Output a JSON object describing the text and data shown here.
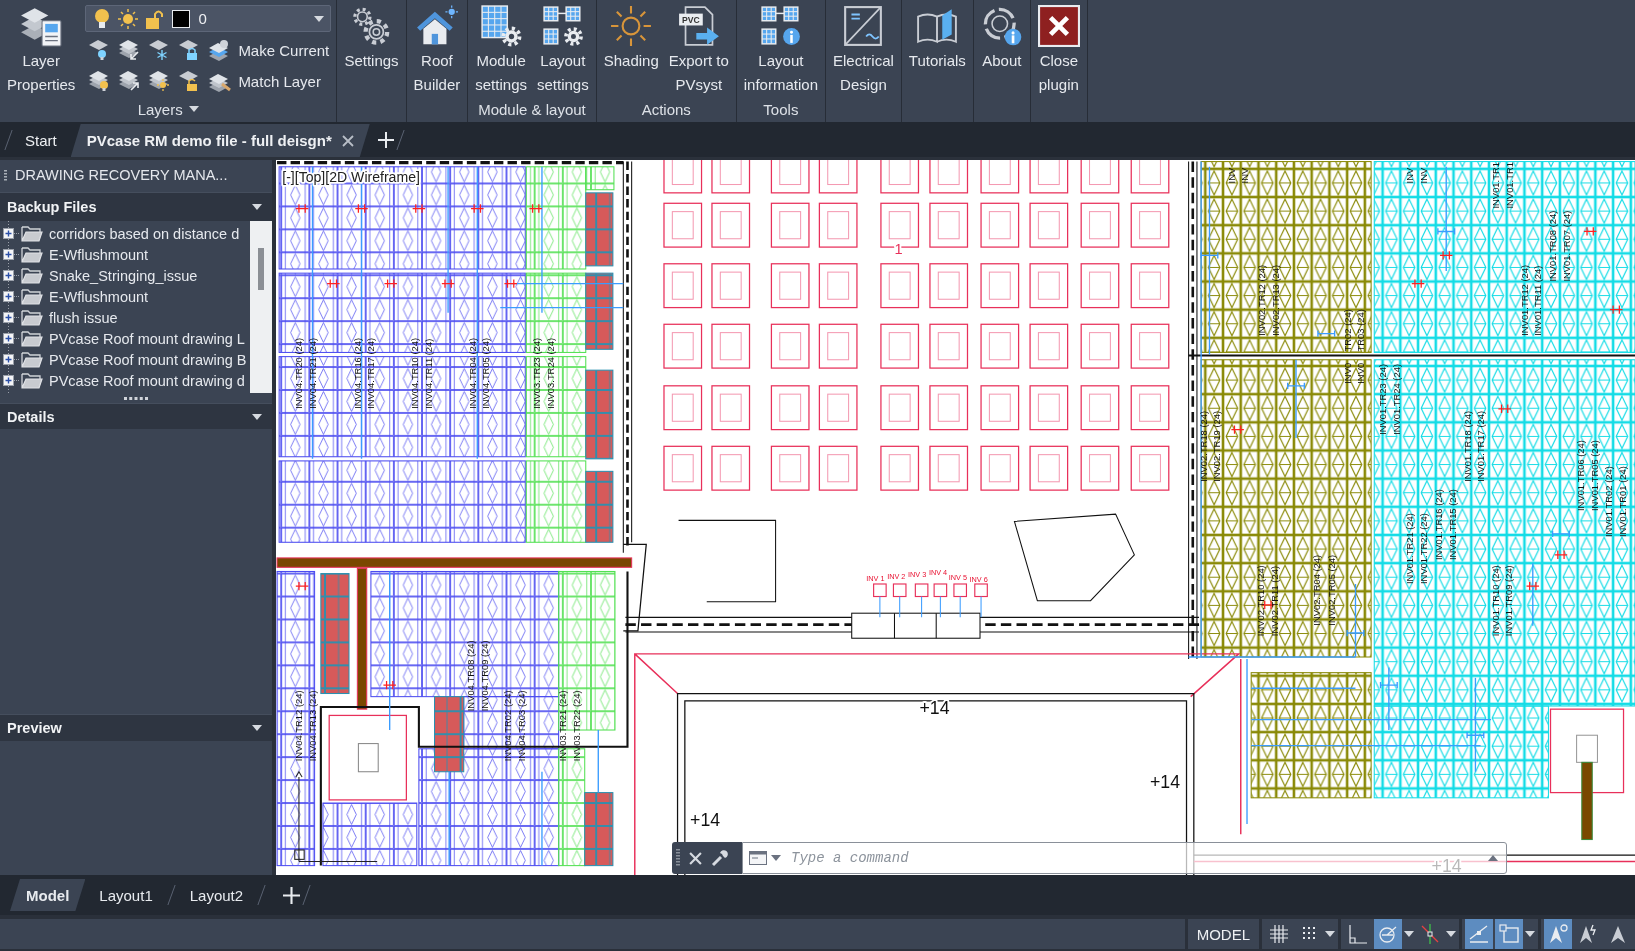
{
  "ribbon": {
    "layers": {
      "title": "Layers",
      "properties_label": [
        "Layer",
        "Properties"
      ],
      "current_layer": "0",
      "tools": [
        {
          "label": "Make Current"
        },
        {
          "label": "Match Layer"
        }
      ]
    },
    "panels": [
      {
        "buttons": [
          {
            "kind": "settings",
            "label": [
              "Settings"
            ]
          }
        ]
      },
      {
        "buttons": [
          {
            "kind": "roof",
            "label": [
              "Roof",
              "Builder"
            ]
          }
        ]
      },
      {
        "title": "Module & layout",
        "buttons": [
          {
            "kind": "module",
            "label": [
              "Module",
              "settings"
            ]
          },
          {
            "kind": "layout",
            "label": [
              "Layout",
              "settings"
            ]
          }
        ]
      },
      {
        "title": "Actions",
        "buttons": [
          {
            "kind": "shading",
            "label": [
              "Shading"
            ]
          },
          {
            "kind": "export",
            "label": [
              "Export to",
              "PVsyst"
            ],
            "icon_text": "PVC"
          }
        ]
      },
      {
        "title": "Tools",
        "buttons": [
          {
            "kind": "info",
            "label": [
              "Layout",
              "information"
            ]
          }
        ]
      },
      {
        "buttons": [
          {
            "kind": "electrical",
            "label": [
              "Electrical",
              "Design"
            ]
          }
        ]
      },
      {
        "buttons": [
          {
            "kind": "tutorials",
            "label": [
              "Tutorials"
            ]
          }
        ]
      },
      {
        "buttons": [
          {
            "kind": "about",
            "label": [
              "About"
            ]
          }
        ]
      },
      {
        "buttons": [
          {
            "kind": "close",
            "label": [
              "Close",
              "plugin"
            ]
          }
        ]
      }
    ]
  },
  "document_tabs": [
    {
      "label": "Start",
      "selected": false
    },
    {
      "label": "PVcase RM demo file - full deisgn*",
      "selected": true
    }
  ],
  "side_panel": {
    "title": "DRAWING RECOVERY MANA...",
    "backup_files": {
      "title": "Backup Files",
      "items": [
        {
          "label": "corridors based on distance d",
          "expanded": false
        },
        {
          "label": "E-Wflushmount",
          "expanded": false
        },
        {
          "label": "Snake_Stringing_issue",
          "expanded": false
        },
        {
          "label": "E-Wflushmount",
          "expanded": false
        },
        {
          "label": "flush issue",
          "expanded": false
        },
        {
          "label": "PVcase Roof mount drawing L",
          "expanded": false
        },
        {
          "label": "PVcase Roof mount drawing B",
          "expanded": false
        },
        {
          "label": "PVcase Roof mount drawing d",
          "expanded": false
        }
      ]
    },
    "details": {
      "title": "Details"
    },
    "preview": {
      "title": "Preview"
    }
  },
  "viewport": {
    "view_label": "[-][Top][2D Wireframe]",
    "string_labels": [
      "INV04.TR20 (24)",
      "INV04.TR21 (24)",
      "INV04.TR16 (24)",
      "INV04.TR17 (24)",
      "INV04.TR10 (24)",
      "INV04.TR11 (24)",
      "INV04.TR04 (24)",
      "INV04.TR05 (24)",
      "INV03.TR23 (24)",
      "INV03.TR24 (24)",
      "INV04.TR12 (24)",
      "INV04.TR13 (24)",
      "INV04.TR08 (24)",
      "INV04.TR09 (24)",
      "INV04.TR02 (24)",
      "INV04.TR03 (24)",
      "INV03.TR21 (24)",
      "INV03.TR22 (24)",
      "INV",
      "INV",
      "INV02.TR12 (24)",
      "INV02.TR13 (24)",
      "INV0",
      "INV0",
      "INV02.TR18 (24)",
      "INV02.TR19 (24)",
      "INV02.TR10 (24)",
      "INV02.TR11 (24)",
      "INV02.TR04 (24)",
      "INV02.TR05 (24)",
      "INV",
      "INV",
      "INV01.TR1",
      "INV01.TR1",
      "INV01.TR23 (24)",
      "INV01.TR24 (24)",
      "INV01.TR18 (24)",
      "INV01.TR17 (24)",
      "INV01.TR12 (24)",
      "INV01.TR11 (24)",
      "INV01.TR08 (24)",
      "INV01.TR07 (24)",
      "INV01.TR06 (24)",
      "INV01.TR05 (24)",
      "INV01.TR02 (24)",
      "INV01.TR01 (24)",
      "INV01.TR21 (24)",
      "INV01.TR22 (24)",
      "INV01.TR16 (24)",
      "INV01.TR15 (24)",
      "INV01.TR10 (24)",
      "INV01.TR09 (24)",
      "TR02 (24)",
      "TR03 (24)"
    ],
    "inverter_labels": [
      "INV 1",
      "INV 2",
      "INV 3",
      "INV 4",
      "INV 5",
      "INV 6"
    ],
    "elevations": [
      "+14",
      "+14",
      "+14",
      "+14"
    ],
    "marker": "1"
  },
  "command_line": {
    "placeholder": "Type a command"
  },
  "layout_tabs": [
    {
      "label": "Model",
      "selected": true
    },
    {
      "label": "Layout1",
      "selected": false
    },
    {
      "label": "Layout2",
      "selected": false
    }
  ],
  "status_bar": {
    "model_label": "MODEL",
    "groups": [
      [
        {
          "kind": "grid",
          "on": false,
          "has_menu": false
        },
        {
          "kind": "snap",
          "on": false,
          "has_menu": true
        }
      ],
      [
        {
          "kind": "ortho",
          "on": false,
          "has_menu": false
        },
        {
          "kind": "polar",
          "on": true,
          "has_menu": true
        },
        {
          "kind": "osnap",
          "on": false,
          "has_menu": true
        }
      ],
      [
        {
          "kind": "isodraft",
          "on": true,
          "has_menu": false
        },
        {
          "kind": "selection",
          "on": true,
          "has_menu": true
        }
      ],
      [
        {
          "kind": "annotation",
          "on": true,
          "has_menu": false
        },
        {
          "kind": "autoscale",
          "on": false,
          "has_menu": false
        },
        {
          "kind": "annoscale",
          "on": false,
          "has_menu": false
        }
      ]
    ]
  }
}
